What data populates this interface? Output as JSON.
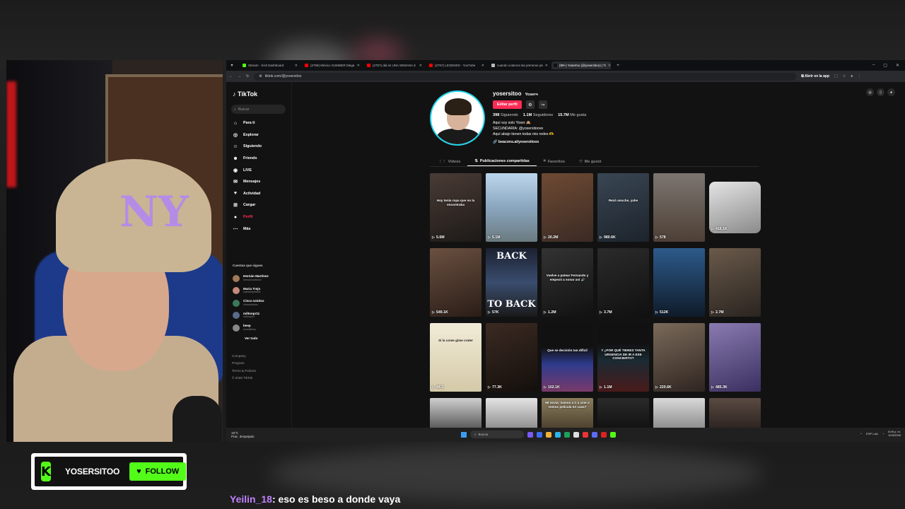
{
  "browser": {
    "tabs": [
      {
        "title": "Stream - Kick Dashboard",
        "fav_color": "#53fc18",
        "active": false
      },
      {
        "title": "(2759) México SUMMER Mega",
        "fav_color": "#ff0000",
        "active": false
      },
      {
        "title": "(2757) dal es UNA SEMANA d",
        "fav_color": "#ff0000",
        "active": false
      },
      {
        "title": "(2757) LEGENDS - YouTube",
        "fav_color": "#ff0000",
        "active": false
      },
      {
        "title": "cuando volamos las primeras pá",
        "fav_color": "#bbbbbb",
        "active": false
      },
      {
        "title": "(99+) Yosermo (@yosersitoo) | Ti",
        "fav_color": "#111111",
        "active": true
      }
    ],
    "url": "tiktok.com/@yosersitoo",
    "open_app": "Abrir en la app"
  },
  "sidebar": {
    "logo": "TikTok",
    "search_placeholder": "Buscar",
    "nav": [
      {
        "label": "Para ti",
        "icon": "home-icon"
      },
      {
        "label": "Explorar",
        "icon": "compass-icon"
      },
      {
        "label": "Siguiendo",
        "icon": "following-icon"
      },
      {
        "label": "Friends",
        "icon": "friends-icon"
      },
      {
        "label": "LIVE",
        "icon": "live-icon"
      },
      {
        "label": "Mensajes",
        "icon": "message-icon"
      },
      {
        "label": "Actividad",
        "icon": "activity-icon"
      },
      {
        "label": "Cargar",
        "icon": "upload-icon"
      },
      {
        "label": "Perfil",
        "icon": "profile-icon"
      },
      {
        "label": "Más",
        "icon": "more-icon"
      }
    ],
    "following_title": "Cuentas que sigues",
    "following": [
      {
        "name": "Hernán Martínez",
        "handle": "hernanmartinezl"
      },
      {
        "name": "Maria Trejo",
        "handle": "mariatrejotiktok"
      },
      {
        "name": "Cinco Unidos",
        "handle": "cincounidoss"
      },
      {
        "name": "miltonpr11",
        "handle": "miltonpr11"
      },
      {
        "name": "beep",
        "handle": "soundbeep"
      }
    ],
    "see_all": "Ver todo",
    "footer": [
      "Company",
      "Program",
      "Terms & Policies",
      "© 2026 TikTok"
    ]
  },
  "profile": {
    "username": "yosersitoo",
    "nickname": "Yoserч",
    "edit_button": "Editar perfil",
    "following_count": "398",
    "following_label": "Siguiendo",
    "followers_count": "1.1M",
    "followers_label": "Seguidores",
    "likes_count": "15.7M",
    "likes_label": "Me gusta",
    "bio_lines": [
      "Aquí soy solo Yoser 🙈",
      "SECUNDARIA: @yosersitoove",
      "Aquí abajo tienen todas mis redes 🫶"
    ],
    "link": "beacons.ai/yosersitoox",
    "tabs": [
      "Videos",
      "Publicaciones compartidas",
      "Favoritos",
      "Me gustó"
    ],
    "active_tab": 1
  },
  "videos": [
    {
      "views": "5.6M",
      "bg": "linear-gradient(160deg,#4a3b35,#1d1a18)",
      "caption": "Hoy tenía ropa que no la encontraba"
    },
    {
      "views": "5.1M",
      "bg": "linear-gradient(180deg,#bcd6ec,#8aa6bf 50%,#6b7a80)",
      "caption": ""
    },
    {
      "views": "20.2M",
      "bg": "linear-gradient(160deg,#6e4a33,#3a2a24)",
      "caption": ""
    },
    {
      "views": "980.6K",
      "bg": "linear-gradient(160deg,#3a4654,#1c232b)",
      "caption": "Rezó anoche, yahe"
    },
    {
      "views": "578",
      "bg": "linear-gradient(180deg,#7c7670,#4d3f36)",
      "caption": ""
    },
    {
      "views": "416.1K",
      "bg": "linear-gradient(160deg,#e4e4e4,#8a8a8a)",
      "caption": "",
      "small": true
    },
    {
      "views": "549.1K",
      "bg": "linear-gradient(160deg,#6a5040,#2a1d17)",
      "caption": ""
    },
    {
      "views": "57K",
      "bg": "linear-gradient(180deg,#1b2030,#3a4d6e 50%,#1a1a1a)",
      "caption": "",
      "big_top": "BACK",
      "big_bottom": "TO BACK"
    },
    {
      "views": "1.2M",
      "bg": "linear-gradient(160deg,#333,#111)",
      "caption": "Vuelve a patear Fernando y empezó a sonar así 🔊"
    },
    {
      "views": "3.7M",
      "bg": "linear-gradient(160deg,#2b2b2b,#101010)",
      "caption": ""
    },
    {
      "views": "512K",
      "bg": "linear-gradient(180deg,#2d5a8a,#0f1b2a)",
      "caption": ""
    },
    {
      "views": "2.7M",
      "bg": "linear-gradient(160deg,#6a5a4a,#2a2420)",
      "caption": ""
    },
    {
      "views": "44.3",
      "bg": "linear-gradient(180deg,#f2ecd8,#d4c9a7)",
      "caption": "Si la come gime crater",
      "dark_caption": true
    },
    {
      "views": "77.3K",
      "bg": "linear-gradient(160deg,#3b2a22,#140f0c)",
      "caption": ""
    },
    {
      "views": "102.1K",
      "bg": "linear-gradient(180deg,#111 35%,#2d3b8c 60%,#7a3a6a)",
      "caption": "Que se decisión tan difícil"
    },
    {
      "views": "1.1M",
      "bg": "linear-gradient(180deg,#111 30%,#1b2a33 55%,#4a1a1a)",
      "caption": "Y ¿POR QUÉ TIENES TANTA URGENCIA DE IR A ESE CONCIERTO?"
    },
    {
      "views": "220.6K",
      "bg": "linear-gradient(160deg,#7a6a5a,#2f2520)",
      "caption": ""
    },
    {
      "views": "485.3K",
      "bg": "linear-gradient(160deg,#8a7ab0,#3a3060)",
      "caption": ""
    },
    {
      "views": "",
      "bg": "linear-gradient(180deg,#cfcfcf,#555)",
      "caption": "",
      "cut": true
    },
    {
      "views": "",
      "bg": "linear-gradient(180deg,#e4e4e4,#8a8a8a)",
      "caption": "",
      "cut": true
    },
    {
      "views": "",
      "bg": "linear-gradient(180deg,#8b7d5e,#4a3f2c)",
      "caption": "Mi novia: Vamos a ir a cine o vemos película en casa?",
      "cut": true
    },
    {
      "views": "",
      "bg": "linear-gradient(180deg,#2a2a2a,#111)",
      "caption": "",
      "cut": true
    },
    {
      "views": "",
      "bg": "linear-gradient(180deg,#d9d9d9,#8a8a8a)",
      "caption": "",
      "cut": true
    },
    {
      "views": "",
      "bg": "linear-gradient(180deg,#5a4a42,#2b2220)",
      "caption": "",
      "cut": true
    }
  ],
  "taskbar": {
    "weather_temp": "19°C",
    "weather_desc": "Prac. despejado",
    "search": "Buscar",
    "lang": "ESP LAA",
    "time": "8:49 p. m.",
    "date": "10/3/2026"
  },
  "overlay": {
    "kick_name": "YOSERSITOO",
    "follow_label": "FOLLOW",
    "chat_user": "Yeilin_18",
    "chat_message": ": eso es beso a donde vaya"
  }
}
